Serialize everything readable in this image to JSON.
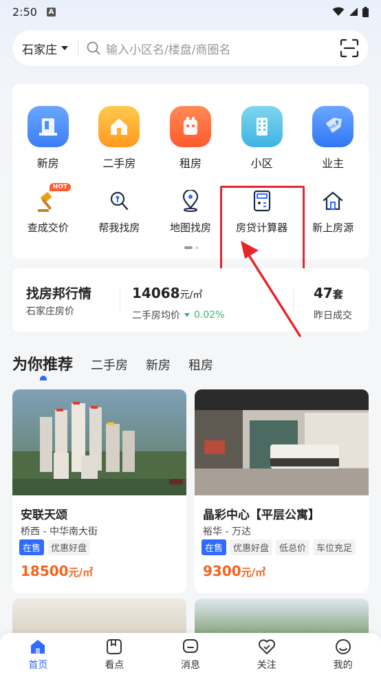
{
  "status_bar": {
    "time": "2:50"
  },
  "search": {
    "city": "石家庄",
    "placeholder": "输入小区名/楼盘/商圈名"
  },
  "nav_row1": [
    {
      "label": "新房",
      "icon": "new-house-icon",
      "color": "#4d8dfc"
    },
    {
      "label": "二手房",
      "icon": "second-hand-house-icon",
      "color": "#ffb02e"
    },
    {
      "label": "租房",
      "icon": "rent-icon",
      "color": "#ff6a3d"
    },
    {
      "label": "小区",
      "icon": "community-icon",
      "color": "#4fc3e8"
    },
    {
      "label": "业主",
      "icon": "owner-sale-icon",
      "color": "#3d8cfc"
    }
  ],
  "nav_row2": [
    {
      "label": "查成交价",
      "icon": "auction-hammer-icon",
      "badge": "HOT"
    },
    {
      "label": "帮我找房",
      "icon": "search-house-icon"
    },
    {
      "label": "地图找房",
      "icon": "map-pin-icon"
    },
    {
      "label": "房贷计算器",
      "icon": "calculator-icon"
    },
    {
      "label": "新上房源",
      "icon": "new-listing-house-icon"
    }
  ],
  "market": {
    "title": "找房邦行情",
    "subtitle": "石家庄房价",
    "avg_price": "14068",
    "avg_price_unit": "元/㎡",
    "avg_label": "二手房均价",
    "avg_change": "0.02%",
    "deals": "47",
    "deals_unit": "套",
    "deals_label": "昨日成交"
  },
  "tabs": [
    "为你推荐",
    "二手房",
    "新房",
    "租房"
  ],
  "listings": [
    {
      "name": "安联天颂",
      "location": "桥西 - 中华南大街",
      "tags": [
        "在售",
        "优惠好盘"
      ],
      "price": "18500",
      "price_unit": "元/㎡"
    },
    {
      "name": "晶彩中心【平层公寓】",
      "location": "裕华 - 万达",
      "tags": [
        "在售",
        "优惠好盘",
        "低总价",
        "车位充足"
      ],
      "price": "9300",
      "price_unit": "元/㎡"
    }
  ],
  "bottom_nav": [
    "首页",
    "看点",
    "消息",
    "关注",
    "我的"
  ],
  "colors": {
    "accent": "#2f6bff",
    "price": "#f5621e",
    "highlight": "#e5262c",
    "down": "#3cb56b"
  }
}
